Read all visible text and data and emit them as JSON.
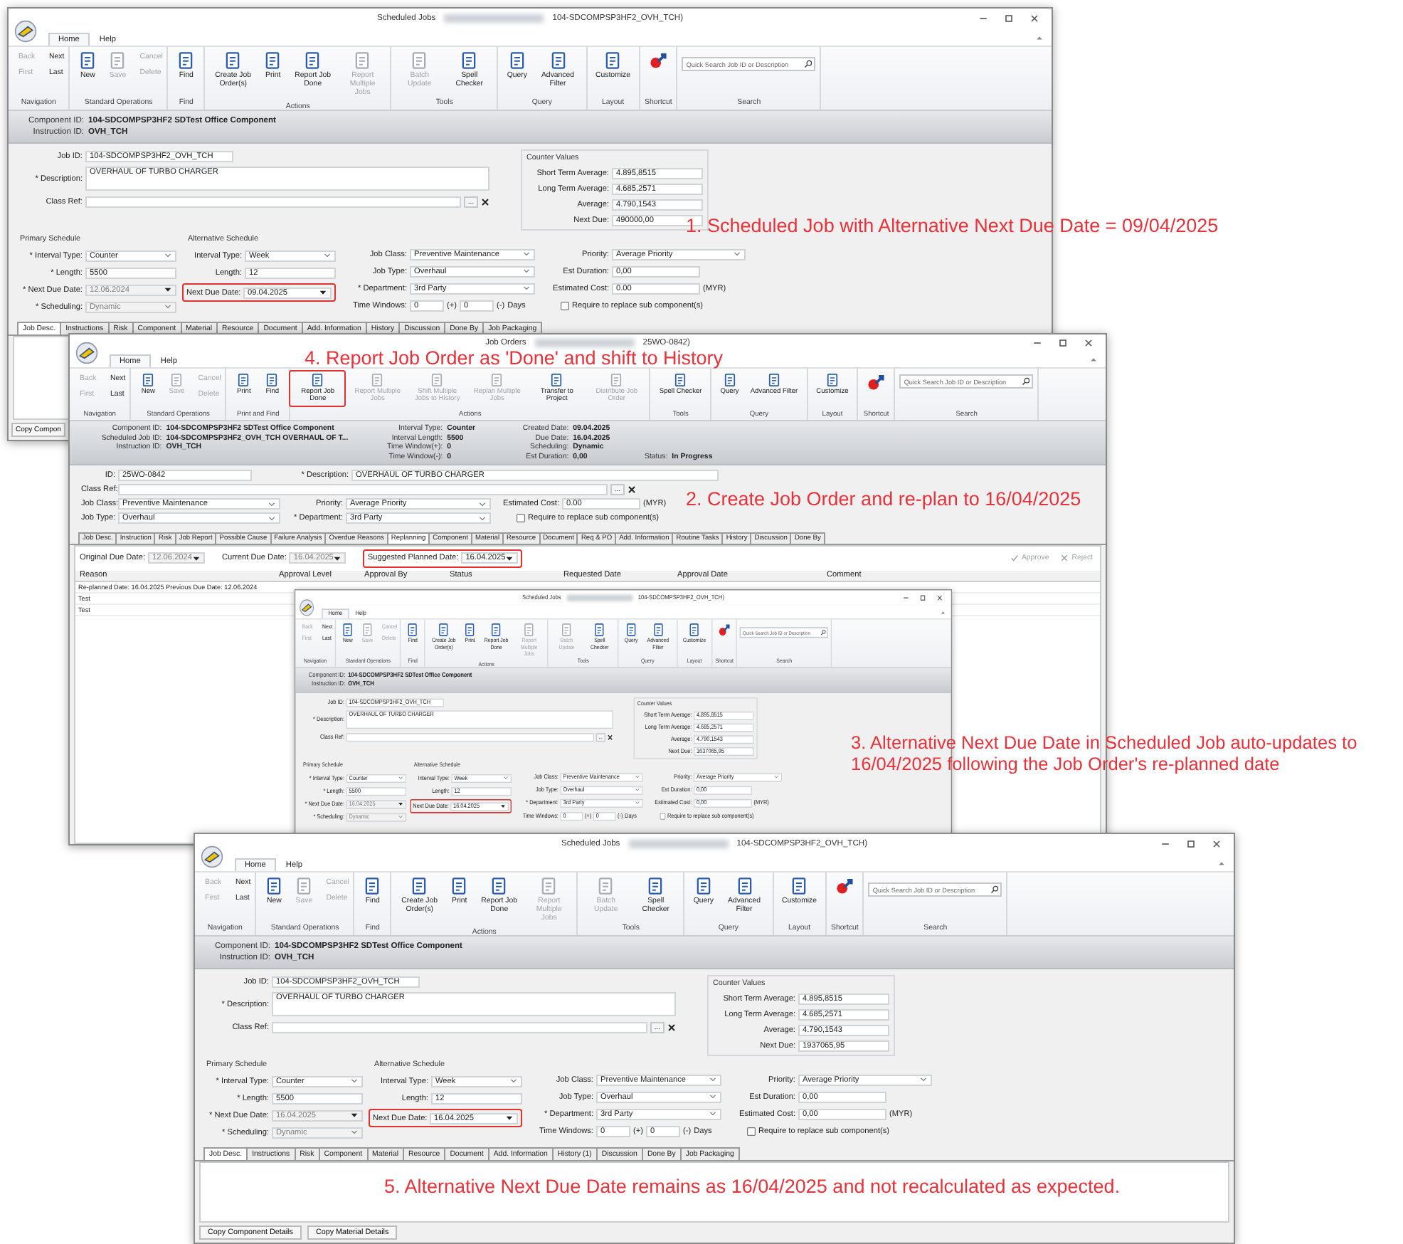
{
  "windows": [
    {
      "kind": "scheduled",
      "title": "Scheduled Jobs",
      "title_suffix": "104-SDCOMPSP3HF2_OVH_TCH)",
      "ribbon_tabs": [
        {
          "label": "Home",
          "selected": true
        },
        {
          "label": "Help",
          "selected": false
        }
      ],
      "ribbon": [
        {
          "group": "Navigation",
          "items": [
            {
              "kind": "small",
              "label": "Back",
              "disabled": true
            },
            {
              "kind": "small",
              "label": "First",
              "disabled": true
            },
            {
              "kind": "small",
              "label": "Next",
              "disabled": false
            },
            {
              "kind": "small",
              "label": "Last",
              "disabled": false
            }
          ]
        },
        {
          "group": "Standard Operations",
          "items": [
            {
              "kind": "large",
              "label": "New",
              "disabled": false
            },
            {
              "kind": "large",
              "label": "Save",
              "disabled": true
            },
            {
              "kind": "small",
              "label": "Cancel",
              "disabled": true
            },
            {
              "kind": "small",
              "label": "Delete",
              "disabled": true
            }
          ]
        },
        {
          "group": "Find",
          "items": [
            {
              "kind": "large",
              "label": "Find",
              "disabled": false
            }
          ]
        },
        {
          "group": "Actions",
          "items": [
            {
              "kind": "large",
              "label": "Create Job Order(s)",
              "disabled": false
            },
            {
              "kind": "large",
              "label": "Print",
              "disabled": false
            },
            {
              "kind": "large",
              "label": "Report Job Done",
              "disabled": false
            },
            {
              "kind": "large",
              "label": "Report Multiple Jobs",
              "disabled": true
            }
          ]
        },
        {
          "group": "Tools",
          "items": [
            {
              "kind": "large",
              "label": "Batch Update",
              "disabled": true
            },
            {
              "kind": "large",
              "label": "Spell Checker",
              "disabled": false
            }
          ]
        },
        {
          "group": "Query",
          "items": [
            {
              "kind": "large",
              "label": "Query",
              "disabled": false
            },
            {
              "kind": "large",
              "label": "Advanced Filter",
              "disabled": false
            }
          ]
        },
        {
          "group": "Layout",
          "items": [
            {
              "kind": "large",
              "label": "Customize",
              "disabled": false
            }
          ]
        },
        {
          "group": "Shortcut",
          "items": [
            {
              "kind": "icon",
              "disabled": false
            }
          ]
        },
        {
          "group": "Search",
          "items": [
            {
              "kind": "search",
              "placeholder": "Quick Search Job ID or Description"
            }
          ]
        }
      ],
      "header": [
        {
          "rows": [
            {
              "label": "Component ID:",
              "value": "104-SDCOMPSP3HF2 SDTest Office Component"
            },
            {
              "label": "Instruction ID:",
              "value": "OVH_TCH"
            }
          ]
        }
      ],
      "form": [
        {
          "columns": [
            {
              "kind": "main",
              "rows": [
                {
                  "kind": "text",
                  "label": "Job ID:",
                  "value": "104-SDCOMPSP3HF2_OVH_TCH"
                },
                {
                  "kind": "textarea",
                  "label": "* Description:",
                  "value": "OVERHAUL OF TURBO CHARGER"
                },
                {
                  "kind": "lookup",
                  "label": "Class Ref:",
                  "button_label": "..."
                }
              ]
            },
            {
              "kind": "counter",
              "heading": "Counter Values",
              "rows": [
                {
                  "kind": "text",
                  "label": "Short Term Average:",
                  "value": "4.895,8515"
                },
                {
                  "kind": "text",
                  "label": "Long Term Average:",
                  "value": "4.685,2571"
                },
                {
                  "kind": "text",
                  "label": "Average:",
                  "value": "4.790,1543"
                },
                {
                  "kind": "text",
                  "label": "Next Due:",
                  "value": "490000,00"
                }
              ]
            }
          ]
        },
        {
          "columns": [
            {
              "kind": "primary",
              "heading": "Primary Schedule",
              "rows": [
                {
                  "kind": "select",
                  "label": "* Interval Type:",
                  "value": "Counter"
                },
                {
                  "kind": "text",
                  "label": "* Length:",
                  "value": "5500"
                },
                {
                  "kind": "date",
                  "label": "* Next Due Date:",
                  "value": "12.06.2024",
                  "disabled": true
                },
                {
                  "kind": "select",
                  "label": "* Scheduling:",
                  "value": "Dynamic",
                  "disabled": true
                }
              ]
            },
            {
              "kind": "alternate",
              "heading": "Alternative Schedule",
              "rows": [
                {
                  "kind": "select",
                  "label": "Interval Type:",
                  "value": "Week"
                },
                {
                  "kind": "text",
                  "label": "Length:",
                  "value": "12"
                },
                {
                  "kind": "date",
                  "label": "Next Due Date:",
                  "value": "09.04.2025",
                  "highlighted": true
                }
              ]
            },
            {
              "kind": "details",
              "rows": [
                {
                  "kind": "select",
                  "label": "Job Class:",
                  "value": "Preventive Maintenance"
                },
                {
                  "kind": "select",
                  "label": "Job Type:",
                  "value": "Overhaul"
                },
                {
                  "kind": "select",
                  "label": "* Department:",
                  "value": "3rd Party"
                },
                {
                  "kind": "range",
                  "label": "Time Windows:",
                  "value": "0",
                  "plus_label": "(+)",
                  "value2": "0",
                  "minus_label": "(-)",
                  "unit": "Days"
                }
              ]
            },
            {
              "kind": "costs",
              "rows": [
                {
                  "kind": "select",
                  "label": "Priority:",
                  "value": "Average Priority"
                },
                {
                  "kind": "text",
                  "label": "Est Duration:",
                  "value": "0,00"
                },
                {
                  "kind": "text",
                  "label": "Estimated Cost:",
                  "value": "0.00",
                  "suffix": "(MYR)"
                },
                {
                  "kind": "checkbox",
                  "label": "Require to replace sub component(s)",
                  "checked": false
                }
              ]
            }
          ]
        }
      ],
      "tabs": [
        {
          "label": "Job Desc.",
          "selected": true
        },
        {
          "label": "Instructions",
          "selected": false
        },
        {
          "label": "Risk",
          "selected": false
        },
        {
          "label": "Component",
          "selected": false
        },
        {
          "label": "Material",
          "selected": false
        },
        {
          "label": "Resource",
          "selected": false
        },
        {
          "label": "Document",
          "selected": false
        },
        {
          "label": "Add. Information",
          "selected": false
        },
        {
          "label": "History",
          "selected": false
        },
        {
          "label": "Discussion",
          "selected": false
        },
        {
          "label": "Done By",
          "selected": false
        },
        {
          "label": "Job Packaging",
          "selected": false
        }
      ],
      "content": {
        "kind": "blank"
      },
      "bottom_buttons": [
        "Copy Compon"
      ]
    },
    {
      "kind": "joborder",
      "title": "Job Orders",
      "title_suffix": "25WO-0842)",
      "ribbon_tabs": [
        {
          "label": "Home",
          "selected": true
        },
        {
          "label": "Help",
          "selected": false
        }
      ],
      "ribbon": [
        {
          "group": "Navigation",
          "items": [
            {
              "kind": "small",
              "label": "Back",
              "disabled": true
            },
            {
              "kind": "small",
              "label": "First",
              "disabled": true
            },
            {
              "kind": "small",
              "label": "Next",
              "disabled": false
            },
            {
              "kind": "small",
              "label": "Last",
              "disabled": false
            }
          ]
        },
        {
          "group": "Standard Operations",
          "items": [
            {
              "kind": "large",
              "label": "New",
              "disabled": false
            },
            {
              "kind": "large",
              "label": "Save",
              "disabled": true
            },
            {
              "kind": "small",
              "label": "Cancel",
              "disabled": true
            },
            {
              "kind": "small",
              "label": "Delete",
              "disabled": true
            }
          ]
        },
        {
          "group": "Print and Find",
          "items": [
            {
              "kind": "large",
              "label": "Print",
              "disabled": false
            },
            {
              "kind": "large",
              "label": "Find",
              "disabled": false
            }
          ]
        },
        {
          "group": "Actions",
          "items": [
            {
              "kind": "large",
              "label": "Report Job Done",
              "disabled": false,
              "highlighted": true
            },
            {
              "kind": "large",
              "label": "Report Multiple Jobs",
              "disabled": true
            },
            {
              "kind": "large",
              "label": "Shift Multiple Jobs to History",
              "disabled": true
            },
            {
              "kind": "large",
              "label": "Replan Multiple Jobs",
              "disabled": true
            },
            {
              "kind": "large",
              "label": "Transfer to Project",
              "disabled": false
            },
            {
              "kind": "large",
              "label": "Distribute Job Order",
              "disabled": true
            }
          ]
        },
        {
          "group": "Tools",
          "items": [
            {
              "kind": "large",
              "label": "Spell Checker",
              "disabled": false
            }
          ]
        },
        {
          "group": "Query",
          "items": [
            {
              "kind": "large",
              "label": "Query",
              "disabled": false
            },
            {
              "kind": "large",
              "label": "Advanced Filter",
              "disabled": false
            }
          ]
        },
        {
          "group": "Layout",
          "items": [
            {
              "kind": "large",
              "label": "Customize",
              "disabled": false
            }
          ]
        },
        {
          "group": "Shortcut",
          "items": [
            {
              "kind": "icon",
              "disabled": false
            }
          ]
        },
        {
          "group": "Search",
          "items": [
            {
              "kind": "search",
              "placeholder": "Quick Search Job ID or Description"
            }
          ]
        }
      ],
      "header": [
        {
          "rows": [
            {
              "label": "Component ID:",
              "value": "104-SDCOMPSP3HF2 SDTest Office Component"
            },
            {
              "label": "Scheduled Job ID:",
              "value": "104-SDCOMPSP3HF2_OVH_TCH OVERHAUL OF T..."
            },
            {
              "label": "Instruction ID:",
              "value": "OVH_TCH"
            }
          ]
        },
        {
          "rows": [
            {
              "label": "Interval Type:",
              "value": "Counter"
            },
            {
              "label": "Interval Length:",
              "value": "5500"
            },
            {
              "label": "Time Window(+):",
              "value": "0"
            },
            {
              "label": "Time Window(-):",
              "value": "0"
            }
          ]
        },
        {
          "rows": [
            {
              "label": "Created Date:",
              "value": "09.04.2025"
            },
            {
              "label": "Due Date:",
              "value": "16.04.2025"
            },
            {
              "label": "Scheduling:",
              "value": "Dynamic"
            },
            {
              "label": "Est Duration:",
              "value": "0,00"
            }
          ]
        },
        {
          "rows": [
            {
              "label": "Status:",
              "value": "In Progress"
            }
          ]
        }
      ],
      "form": [
        {
          "columns": [
            {
              "kind": "joid",
              "rows": [
                {
                  "kind": "text",
                  "label": "ID:",
                  "value": "25WO-0842"
                }
              ]
            },
            {
              "kind": "jodesc",
              "rows": [
                {
                  "kind": "text",
                  "label": "* Description:",
                  "value": "OVERHAUL OF TURBO CHARGER"
                }
              ]
            }
          ]
        },
        {
          "columns": [
            {
              "kind": "jowide",
              "rows": [
                {
                  "kind": "lookup",
                  "label": "Class Ref:",
                  "button_label": "..."
                }
              ]
            }
          ]
        },
        {
          "columns": [
            {
              "kind": "joa",
              "rows": [
                {
                  "kind": "select",
                  "label": "Job Class:",
                  "value": "Preventive Maintenance"
                },
                {
                  "kind": "select",
                  "label": "Job Type:",
                  "value": "Overhaul"
                }
              ]
            },
            {
              "kind": "job",
              "rows": [
                {
                  "kind": "select",
                  "label": "Priority:",
                  "value": "Average Priority"
                },
                {
                  "kind": "select",
                  "label": "* Department:",
                  "value": "3rd Party"
                }
              ]
            },
            {
              "kind": "joc",
              "rows": [
                {
                  "kind": "text",
                  "label": "Estimated Cost:",
                  "value": "0.00",
                  "suffix": "(MYR)"
                },
                {
                  "kind": "checkbox",
                  "label": "Require to replace sub component(s)",
                  "checked": false
                }
              ]
            }
          ]
        }
      ],
      "tabs": [
        {
          "label": "Job Desc.",
          "selected": false
        },
        {
          "label": "Instruction",
          "selected": false
        },
        {
          "label": "Risk",
          "selected": false
        },
        {
          "label": "Job Report",
          "selected": false
        },
        {
          "label": "Possible Cause",
          "selected": false
        },
        {
          "label": "Failure Analysis",
          "selected": false
        },
        {
          "label": "Overdue Reasons",
          "selected": false
        },
        {
          "label": "Replanning",
          "selected": true
        },
        {
          "label": "Component",
          "selected": false
        },
        {
          "label": "Material",
          "selected": false
        },
        {
          "label": "Resource",
          "selected": false
        },
        {
          "label": "Document",
          "selected": false
        },
        {
          "label": "Req & PO",
          "selected": false
        },
        {
          "label": "Add. Information",
          "selected": false
        },
        {
          "label": "Routine Tasks",
          "selected": false
        },
        {
          "label": "History",
          "selected": false
        },
        {
          "label": "Discussion",
          "selected": false
        },
        {
          "label": "Done By",
          "selected": false
        }
      ],
      "content": {
        "kind": "replanning",
        "fields": [
          {
            "kind": "date",
            "label": "Original Due Date:",
            "value": "12.06.2024",
            "disabled": true
          },
          {
            "kind": "date",
            "label": "Current Due Date:",
            "value": "16.04.2025",
            "disabled": true
          },
          {
            "kind": "date",
            "label": "Suggested Planned Date:",
            "value": "16.04.2025",
            "highlighted": true
          }
        ],
        "actions": [
          {
            "label": "Approve",
            "disabled": true
          },
          {
            "label": "Reject",
            "disabled": true
          }
        ],
        "columns": [
          "Reason",
          "Approval Level",
          "Approval By",
          "Status",
          "Requested Date",
          "Approval Date",
          "Comment"
        ],
        "rows": [
          {
            "cells": [
              "Re-planned Date: 16.04.2025   Previous Due Date: 12.06.2024"
            ]
          },
          {
            "cells": [
              "Test"
            ]
          },
          {
            "cells": [
              "Test"
            ]
          }
        ]
      }
    },
    {
      "kind": "scheduled",
      "title": "Scheduled Jobs",
      "title_suffix": "104-SDCOMPSP3HF2_OVH_TCH)",
      "ribbon_tabs": [
        {
          "label": "Home",
          "selected": true
        },
        {
          "label": "Help",
          "selected": false
        }
      ],
      "ribbon": [
        {
          "group": "Navigation",
          "items": [
            {
              "kind": "small",
              "label": "Back",
              "disabled": true
            },
            {
              "kind": "small",
              "label": "First",
              "disabled": true
            },
            {
              "kind": "small",
              "label": "Next",
              "disabled": false
            },
            {
              "kind": "small",
              "label": "Last",
              "disabled": false
            }
          ]
        },
        {
          "group": "Standard Operations",
          "items": [
            {
              "kind": "large",
              "label": "New",
              "disabled": false
            },
            {
              "kind": "large",
              "label": "Save",
              "disabled": true
            },
            {
              "kind": "small",
              "label": "Cancel",
              "disabled": true
            },
            {
              "kind": "small",
              "label": "Delete",
              "disabled": true
            }
          ]
        },
        {
          "group": "Find",
          "items": [
            {
              "kind": "large",
              "label": "Find",
              "disabled": false
            }
          ]
        },
        {
          "group": "Actions",
          "items": [
            {
              "kind": "large",
              "label": "Create Job Order(s)",
              "disabled": false
            },
            {
              "kind": "large",
              "label": "Print",
              "disabled": false
            },
            {
              "kind": "large",
              "label": "Report Job Done",
              "disabled": false
            },
            {
              "kind": "large",
              "label": "Report Multiple Jobs",
              "disabled": true
            }
          ]
        },
        {
          "group": "Tools",
          "items": [
            {
              "kind": "large",
              "label": "Batch Update",
              "disabled": true
            },
            {
              "kind": "large",
              "label": "Spell Checker",
              "disabled": false
            }
          ]
        },
        {
          "group": "Query",
          "items": [
            {
              "kind": "large",
              "label": "Query",
              "disabled": false
            },
            {
              "kind": "large",
              "label": "Advanced Filter",
              "disabled": false
            }
          ]
        },
        {
          "group": "Layout",
          "items": [
            {
              "kind": "large",
              "label": "Customize",
              "disabled": false
            }
          ]
        },
        {
          "group": "Shortcut",
          "items": [
            {
              "kind": "icon",
              "disabled": false
            }
          ]
        },
        {
          "group": "Search",
          "items": [
            {
              "kind": "search",
              "placeholder": "Quick Search Job ID or Description"
            }
          ]
        }
      ],
      "header": [
        {
          "rows": [
            {
              "label": "Component ID:",
              "value": "104-SDCOMPSP3HF2 SDTest Office Component"
            },
            {
              "label": "Instruction ID:",
              "value": "OVH_TCH"
            }
          ]
        }
      ],
      "form": [
        {
          "columns": [
            {
              "kind": "main",
              "rows": [
                {
                  "kind": "text",
                  "label": "Job ID:",
                  "value": "104-SDCOMPSP3HF2_OVH_TCH"
                },
                {
                  "kind": "textarea",
                  "label": "* Description:",
                  "value": "OVERHAUL OF TURBO CHARGER"
                },
                {
                  "kind": "lookup",
                  "label": "Class Ref:",
                  "button_label": "..."
                }
              ]
            },
            {
              "kind": "counter",
              "heading": "Counter Values",
              "rows": [
                {
                  "kind": "text",
                  "label": "Short Term Average:",
                  "value": "4.895,8515"
                },
                {
                  "kind": "text",
                  "label": "Long Term Average:",
                  "value": "4.685,2571"
                },
                {
                  "kind": "text",
                  "label": "Average:",
                  "value": "4.790,1543"
                },
                {
                  "kind": "text",
                  "label": "Next Due:",
                  "value": "1637065,95"
                }
              ]
            }
          ]
        },
        {
          "columns": [
            {
              "kind": "primary",
              "heading": "Primary Schedule",
              "rows": [
                {
                  "kind": "select",
                  "label": "* Interval Type:",
                  "value": "Counter"
                },
                {
                  "kind": "text",
                  "label": "* Length:",
                  "value": "5500"
                },
                {
                  "kind": "date",
                  "label": "* Next Due Date:",
                  "value": "16.04.2025",
                  "disabled": true
                },
                {
                  "kind": "select",
                  "label": "* Scheduling:",
                  "value": "Dynamic",
                  "disabled": true
                }
              ]
            },
            {
              "kind": "alternate",
              "heading": "Alternative Schedule",
              "rows": [
                {
                  "kind": "select",
                  "label": "Interval Type:",
                  "value": "Week"
                },
                {
                  "kind": "text",
                  "label": "Length:",
                  "value": "12"
                },
                {
                  "kind": "date",
                  "label": "Next Due Date:",
                  "value": "16.04.2025",
                  "highlighted": true
                }
              ]
            },
            {
              "kind": "details",
              "rows": [
                {
                  "kind": "select",
                  "label": "Job Class:",
                  "value": "Preventive Maintenance"
                },
                {
                  "kind": "select",
                  "label": "Job Type:",
                  "value": "Overhaul"
                },
                {
                  "kind": "select",
                  "label": "* Department:",
                  "value": "3rd Party"
                },
                {
                  "kind": "range",
                  "label": "Time Windows:",
                  "value": "0",
                  "plus_label": "(+)",
                  "value2": "0",
                  "minus_label": "(-)",
                  "unit": "Days"
                }
              ]
            },
            {
              "kind": "costs",
              "rows": [
                {
                  "kind": "select",
                  "label": "Priority:",
                  "value": "Average Priority"
                },
                {
                  "kind": "text",
                  "label": "Est Duration:",
                  "value": "0,00"
                },
                {
                  "kind": "text",
                  "label": "Estimated Cost:",
                  "value": "0,00",
                  "suffix": "(MYR)"
                },
                {
                  "kind": "checkbox",
                  "label": "Require to replace sub component(s)",
                  "checked": false
                }
              ]
            }
          ]
        }
      ]
    },
    {
      "kind": "scheduled",
      "title": "Scheduled Jobs",
      "title_suffix": "104-SDCOMPSP3HF2_OVH_TCH)",
      "ribbon_tabs": [
        {
          "label": "Home",
          "selected": true
        },
        {
          "label": "Help",
          "selected": false
        }
      ],
      "ribbon": [
        {
          "group": "Navigation",
          "items": [
            {
              "kind": "small",
              "label": "Back",
              "disabled": true
            },
            {
              "kind": "small",
              "label": "First",
              "disabled": true
            },
            {
              "kind": "small",
              "label": "Next",
              "disabled": false
            },
            {
              "kind": "small",
              "label": "Last",
              "disabled": false
            }
          ]
        },
        {
          "group": "Standard Operations",
          "items": [
            {
              "kind": "large",
              "label": "New",
              "disabled": false
            },
            {
              "kind": "large",
              "label": "Save",
              "disabled": true
            },
            {
              "kind": "small",
              "label": "Cancel",
              "disabled": true
            },
            {
              "kind": "small",
              "label": "Delete",
              "disabled": true
            }
          ]
        },
        {
          "group": "Find",
          "items": [
            {
              "kind": "large",
              "label": "Find",
              "disabled": false
            }
          ]
        },
        {
          "group": "Actions",
          "items": [
            {
              "kind": "large",
              "label": "Create Job Order(s)",
              "disabled": false
            },
            {
              "kind": "large",
              "label": "Print",
              "disabled": false
            },
            {
              "kind": "large",
              "label": "Report Job Done",
              "disabled": false
            },
            {
              "kind": "large",
              "label": "Report Multiple Jobs",
              "disabled": true
            }
          ]
        },
        {
          "group": "Tools",
          "items": [
            {
              "kind": "large",
              "label": "Batch Update",
              "disabled": true
            },
            {
              "kind": "large",
              "label": "Spell Checker",
              "disabled": false
            }
          ]
        },
        {
          "group": "Query",
          "items": [
            {
              "kind": "large",
              "label": "Query",
              "disabled": false
            },
            {
              "kind": "large",
              "label": "Advanced Filter",
              "disabled": false
            }
          ]
        },
        {
          "group": "Layout",
          "items": [
            {
              "kind": "large",
              "label": "Customize",
              "disabled": false
            }
          ]
        },
        {
          "group": "Shortcut",
          "items": [
            {
              "kind": "icon",
              "disabled": false
            }
          ]
        },
        {
          "group": "Search",
          "items": [
            {
              "kind": "search",
              "placeholder": "Quick Search Job ID or Description"
            }
          ]
        }
      ],
      "header": [
        {
          "rows": [
            {
              "label": "Component ID:",
              "value": "104-SDCOMPSP3HF2 SDTest Office Component"
            },
            {
              "label": "Instruction ID:",
              "value": "OVH_TCH"
            }
          ]
        }
      ],
      "form": [
        {
          "columns": [
            {
              "kind": "main",
              "rows": [
                {
                  "kind": "text",
                  "label": "Job ID:",
                  "value": "104-SDCOMPSP3HF2_OVH_TCH"
                },
                {
                  "kind": "textarea",
                  "label": "* Description:",
                  "value": "OVERHAUL OF TURBO CHARGER"
                },
                {
                  "kind": "lookup",
                  "label": "Class Ref:",
                  "button_label": "..."
                }
              ]
            },
            {
              "kind": "counter",
              "heading": "Counter Values",
              "rows": [
                {
                  "kind": "text",
                  "label": "Short Term Average:",
                  "value": "4.895,8515"
                },
                {
                  "kind": "text",
                  "label": "Long Term Average:",
                  "value": "4.685,2571"
                },
                {
                  "kind": "text",
                  "label": "Average:",
                  "value": "4.790,1543"
                },
                {
                  "kind": "text",
                  "label": "Next Due:",
                  "value": "1937065,95"
                }
              ]
            }
          ]
        },
        {
          "columns": [
            {
              "kind": "primary",
              "heading": "Primary Schedule",
              "rows": [
                {
                  "kind": "select",
                  "label": "* Interval Type:",
                  "value": "Counter"
                },
                {
                  "kind": "text",
                  "label": "* Length:",
                  "value": "5500"
                },
                {
                  "kind": "date",
                  "label": "* Next Due Date:",
                  "value": "16.04.2025",
                  "disabled": true
                },
                {
                  "kind": "select",
                  "label": "* Scheduling:",
                  "value": "Dynamic",
                  "disabled": true
                }
              ]
            },
            {
              "kind": "alternate",
              "heading": "Alternative Schedule",
              "rows": [
                {
                  "kind": "select",
                  "label": "Interval Type:",
                  "value": "Week"
                },
                {
                  "kind": "text",
                  "label": "Length:",
                  "value": "12"
                },
                {
                  "kind": "date",
                  "label": "Next Due Date:",
                  "value": "16.04.2025",
                  "highlighted": true
                }
              ]
            },
            {
              "kind": "details",
              "rows": [
                {
                  "kind": "select",
                  "label": "Job Class:",
                  "value": "Preventive Maintenance"
                },
                {
                  "kind": "select",
                  "label": "Job Type:",
                  "value": "Overhaul"
                },
                {
                  "kind": "select",
                  "label": "* Department:",
                  "value": "3rd Party"
                },
                {
                  "kind": "range",
                  "label": "Time Windows:",
                  "value": "0",
                  "plus_label": "(+)",
                  "value2": "0",
                  "minus_label": "(-)",
                  "unit": "Days"
                }
              ]
            },
            {
              "kind": "costs",
              "rows": [
                {
                  "kind": "select",
                  "label": "Priority:",
                  "value": "Average Priority"
                },
                {
                  "kind": "text",
                  "label": "Est Duration:",
                  "value": "0,00"
                },
                {
                  "kind": "text",
                  "label": "Estimated Cost:",
                  "value": "0,00",
                  "suffix": "(MYR)"
                },
                {
                  "kind": "checkbox",
                  "label": "Require to replace sub component(s)",
                  "checked": false
                }
              ]
            }
          ]
        }
      ],
      "tabs": [
        {
          "label": "Job Desc.",
          "selected": true
        },
        {
          "label": "Instructions",
          "selected": false
        },
        {
          "label": "Risk",
          "selected": false
        },
        {
          "label": "Component",
          "selected": false
        },
        {
          "label": "Material",
          "selected": false
        },
        {
          "label": "Resource",
          "selected": false
        },
        {
          "label": "Document",
          "selected": false
        },
        {
          "label": "Add. Information",
          "selected": false
        },
        {
          "label": "History (1)",
          "selected": false
        },
        {
          "label": "Discussion",
          "selected": false
        },
        {
          "label": "Done By",
          "selected": false
        },
        {
          "label": "Job Packaging",
          "selected": false
        }
      ],
      "content": {
        "kind": "blank"
      },
      "bottom_buttons": [
        "Copy Component Details",
        "Copy Material Details"
      ]
    }
  ],
  "annotations": [
    "1. Scheduled Job with Alternative Next Due Date = 09/04/2025",
    "4. Report Job Order as 'Done' and shift to History",
    "2. Create Job Order and re-plan to 16/04/2025",
    "3. Alternative Next Due Date in Scheduled Job auto-updates to 16/04/2025 following the Job Order's re-planned date",
    "5. Alternative Next Due Date remains as 16/04/2025 and not recalculated as expected."
  ]
}
